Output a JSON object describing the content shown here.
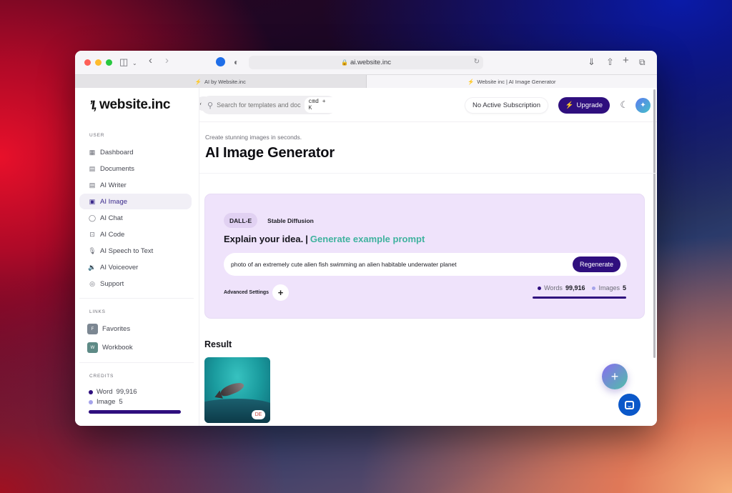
{
  "browser": {
    "url": "ai.website.inc",
    "tabs": [
      {
        "label": "AI by Website.inc",
        "active": false
      },
      {
        "label": "Website inc | AI Image Generator",
        "active": true
      }
    ]
  },
  "sidebar": {
    "brand": "website.inc",
    "user_section_label": "USER",
    "items": [
      {
        "label": "Dashboard",
        "icon": "grid-icon"
      },
      {
        "label": "Documents",
        "icon": "archive-icon"
      },
      {
        "label": "AI Writer",
        "icon": "document-icon"
      },
      {
        "label": "AI Image",
        "icon": "image-icon",
        "active": true
      },
      {
        "label": "AI Chat",
        "icon": "chat-icon"
      },
      {
        "label": "AI Code",
        "icon": "terminal-icon"
      },
      {
        "label": "AI Speech to Text",
        "icon": "microphone-icon"
      },
      {
        "label": "AI Voiceover",
        "icon": "speaker-icon"
      },
      {
        "label": "Support",
        "icon": "lifebuoy-icon"
      }
    ],
    "links_section_label": "LINKS",
    "links": [
      {
        "label": "Favorites",
        "badge": "F",
        "color": "#7c8792"
      },
      {
        "label": "Workbook",
        "badge": "W",
        "color": "#5e8a86"
      }
    ],
    "credits_section_label": "CREDITS",
    "credits": [
      {
        "label": "Word",
        "value": "99,916",
        "color": "#2f0f7e"
      },
      {
        "label": "Image",
        "value": "5",
        "color": "#a5a3ea"
      }
    ]
  },
  "topbar": {
    "search_placeholder": "Search for templates and documents...",
    "shortcut": "cmd + K",
    "subscription_label": "No Active Subscription",
    "upgrade_label": "Upgrade"
  },
  "page": {
    "subtitle": "Create stunning images in seconds.",
    "title": "AI Image Generator"
  },
  "generator": {
    "engines": [
      {
        "label": "DALL-E",
        "active": true
      },
      {
        "label": "Stable Diffusion",
        "active": false
      }
    ],
    "heading": "Explain your idea.",
    "separator": "|",
    "example_link": "Generate example prompt",
    "prompt_value": "photo of an extremely cute alien fish swimming an alien habitable underwater planet",
    "regenerate_label": "Regenerate",
    "advanced_settings_label": "Advanced Settings",
    "usage": {
      "words_label": "Words",
      "words_value": "99,916",
      "images_label": "Images",
      "images_value": "5"
    }
  },
  "result": {
    "title": "Result",
    "images": [
      {
        "alt": "alien fish swimming underwater",
        "badge": "DE"
      }
    ]
  },
  "colors": {
    "accent": "#2f0f7e",
    "link_green": "#3fb29e",
    "card_bg": "#efe3fb"
  }
}
